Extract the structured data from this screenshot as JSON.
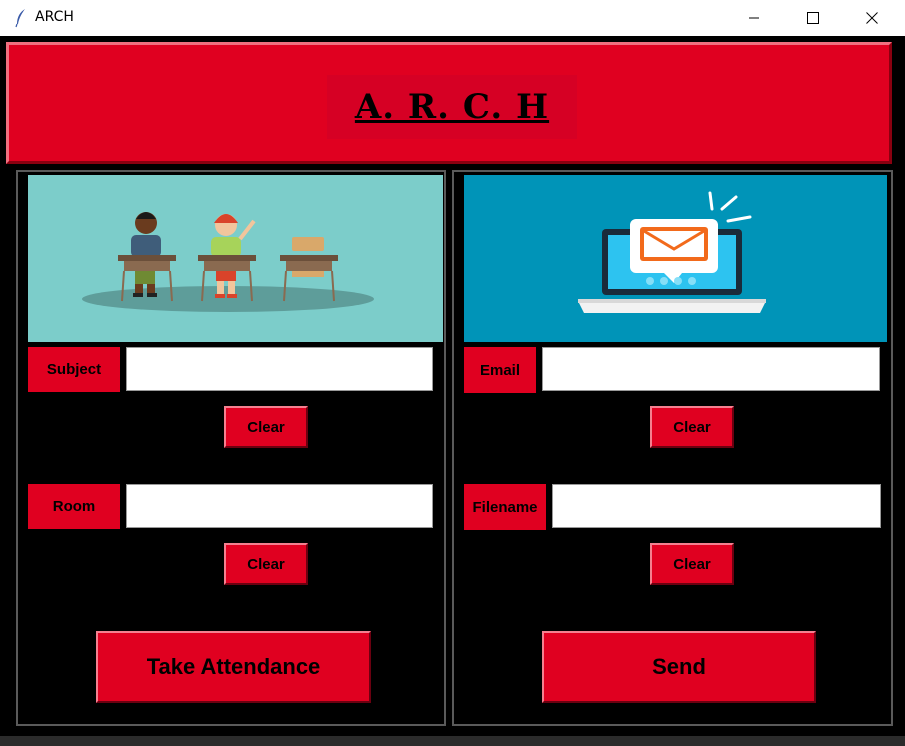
{
  "window": {
    "title": "ARCH",
    "icon": "feather-icon",
    "controls": [
      "minimize-icon",
      "maximize-icon",
      "close-icon"
    ]
  },
  "header": {
    "title": "A. R. C. H"
  },
  "left_panel": {
    "image": "classroom-students-illustration",
    "subject_label": "Subject",
    "subject_value": "",
    "clear_subject": "Clear",
    "room_label": "Room",
    "room_value": "",
    "clear_room": "Clear",
    "take_attendance": "Take Attendance"
  },
  "right_panel": {
    "image": "laptop-email-notification-illustration",
    "email_label": "Email",
    "email_value": "",
    "clear_email": "Clear",
    "filename_label": "Filename",
    "filename_value": "",
    "clear_filename": "Clear",
    "send": "Send"
  },
  "colors": {
    "accent_red": "#e00020",
    "background": "#000000",
    "classroom_bg": "#7ccdca",
    "mail_bg": "#0094b8"
  }
}
